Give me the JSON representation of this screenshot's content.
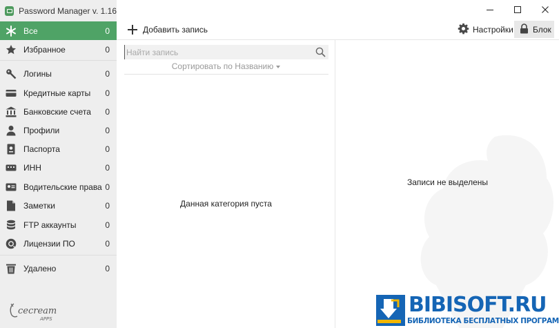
{
  "app": {
    "title": "Password Manager v. 1.16"
  },
  "colors": {
    "accent": "#4fa366",
    "watermark_blue": "#1565b5"
  },
  "sidebar": {
    "items": [
      {
        "name": "all",
        "label": "Все",
        "count": "0",
        "icon": "asterisk-icon",
        "active": true
      },
      {
        "name": "favorites",
        "label": "Избранное",
        "count": "0",
        "icon": "star-icon"
      },
      {
        "name": "logins",
        "label": "Логины",
        "count": "0",
        "icon": "key-icon"
      },
      {
        "name": "credit-cards",
        "label": "Кредитные карты",
        "count": "0",
        "icon": "credit-card-icon"
      },
      {
        "name": "bank-accounts",
        "label": "Банковские счета",
        "count": "0",
        "icon": "bank-icon"
      },
      {
        "name": "profiles",
        "label": "Профили",
        "count": "0",
        "icon": "person-icon"
      },
      {
        "name": "passports",
        "label": "Паспорта",
        "count": "0",
        "icon": "passport-icon"
      },
      {
        "name": "inn",
        "label": "ИНН",
        "count": "0",
        "icon": "id-card-icon"
      },
      {
        "name": "driver-license",
        "label": "Водительские права",
        "count": "0",
        "icon": "license-icon"
      },
      {
        "name": "notes",
        "label": "Заметки",
        "count": "0",
        "icon": "note-icon"
      },
      {
        "name": "ftp",
        "label": "FTP аккаунты",
        "count": "0",
        "icon": "database-icon"
      },
      {
        "name": "licenses",
        "label": "Лицензии ПО",
        "count": "0",
        "icon": "certificate-icon"
      },
      {
        "name": "deleted",
        "label": "Удалено",
        "count": "0",
        "icon": "trash-icon"
      }
    ],
    "brand": {
      "name": "Icecream",
      "sub": "APPS"
    }
  },
  "toolbar": {
    "add_label": "Добавить запись",
    "settings_label": "Настройки",
    "lock_label": "Блок"
  },
  "list": {
    "search_placeholder": "Найти запись",
    "sort_label": "Сортировать по Названию",
    "empty_message": "Данная категория пуста"
  },
  "detail": {
    "empty_message": "Записи не выделены"
  },
  "watermark": {
    "title": "BIBISOFT.RU",
    "subtitle": "БИБЛИОТЕКА БЕСПЛАТНЫХ ПРОГРАММ"
  }
}
